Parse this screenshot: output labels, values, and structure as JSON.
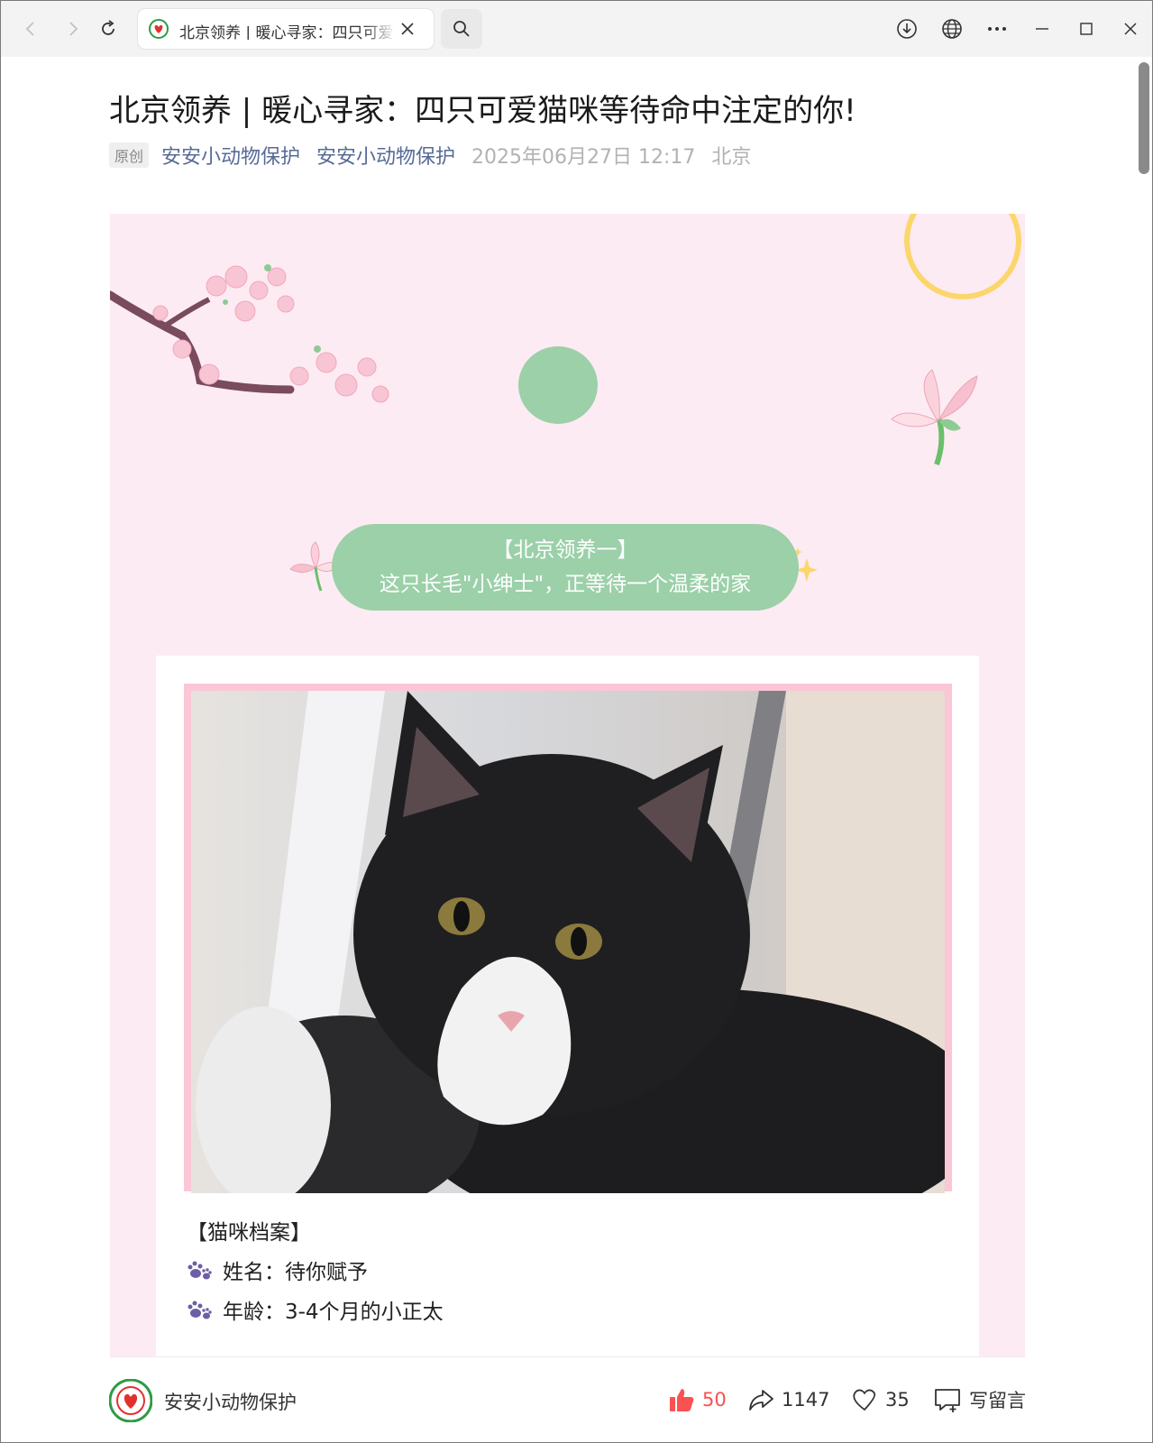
{
  "browser": {
    "tab_title": "北京领养 | 暖心寻家：四只可爱猫咪等待命中注定的你!"
  },
  "article": {
    "title": "北京领养 | 暖心寻家：四只可爱猫咪等待命中注定的你!",
    "badge": "原创",
    "author": "安安小动物保护",
    "account": "安安小动物保护",
    "date": "2025年06月27日 12:17",
    "location": "北京"
  },
  "poster": {
    "bubble_line1": "【北京领养一】",
    "bubble_line2": "这只长毛\"小绅士\"，正等待一个温柔的家",
    "profile_heading": "【猫咪档案】",
    "profile_items": [
      {
        "icon": "paw-icon",
        "text": "姓名：待你赋予"
      },
      {
        "icon": "paw-icon",
        "text": "年龄：3-4个月的小正太"
      }
    ],
    "colors": {
      "background": "#fdebf3",
      "bubble": "#9bd0a9",
      "frame": "#fbc6d6"
    }
  },
  "bottom": {
    "account_name": "安安小动物保护",
    "likes": "50",
    "shares": "1147",
    "favorites": "35",
    "comment_label": "写留言",
    "like_color": "#fa5151"
  }
}
